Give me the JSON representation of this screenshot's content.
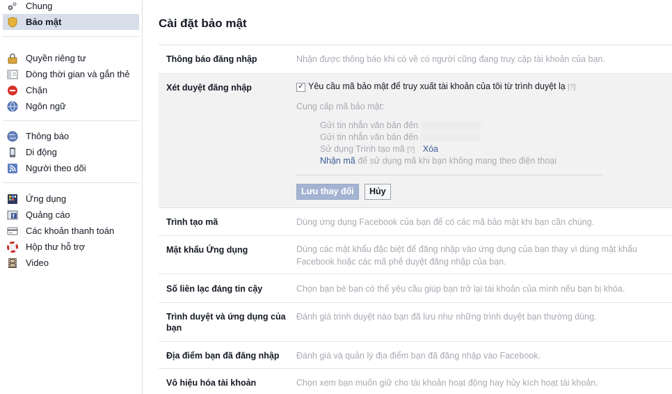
{
  "sidebar": {
    "groups": [
      [
        {
          "label": "Chung",
          "icon": "gears-icon"
        },
        {
          "label": "Bảo mật",
          "icon": "shield-icon",
          "active": true
        }
      ],
      [
        {
          "label": "Quyền riêng tư",
          "icon": "lock-icon"
        },
        {
          "label": "Dòng thời gian và gắn thẻ",
          "icon": "timeline-icon"
        },
        {
          "label": "Chặn",
          "icon": "block-icon"
        },
        {
          "label": "Ngôn ngữ",
          "icon": "globe-icon"
        }
      ],
      [
        {
          "label": "Thông báo",
          "icon": "globe-notification-icon"
        },
        {
          "label": "Di động",
          "icon": "mobile-icon"
        },
        {
          "label": "Người theo dõi",
          "icon": "rss-icon"
        }
      ],
      [
        {
          "label": "Ứng dụng",
          "icon": "apps-icon"
        },
        {
          "label": "Quảng cáo",
          "icon": "ads-icon"
        },
        {
          "label": "Các khoản thanh toán",
          "icon": "credit-card-icon"
        },
        {
          "label": "Hộp thư hỗ trợ",
          "icon": "lifebuoy-icon"
        },
        {
          "label": "Video",
          "icon": "film-icon"
        }
      ]
    ]
  },
  "main": {
    "title": "Cài đặt bảo mật",
    "login_notifications": {
      "label": "Thông báo đăng nhập",
      "desc": "Nhận được thông báo khi có về có người cũng đang truy cập tài khoản của bạn."
    },
    "login_approvals": {
      "label": "Xét duyệt đăng nhập",
      "checkbox_label": "Yêu cầu mã bảo mật để truy xuất tài khoản của tôi từ trình duyệt lạ",
      "checkbox_checked": true,
      "help": "[?]",
      "provide_heading": "Cung cấp mã bảo mật:",
      "sms_1": "Gửi tin nhắn văn bản đến",
      "sms_2": "Gửi tin nhắn văn bản đến",
      "code_gen": "Sử dụng Trình tạo mã",
      "code_gen_help": "[?]",
      "delete_link": "Xóa",
      "get_codes_link": "Nhận mã",
      "get_codes_rest": "để sử dụng mã khi bạn không mang theo điện thoại",
      "save_button": "Lưu thay đổi",
      "cancel_button": "Hủy"
    },
    "rows": [
      {
        "label": "Trình tạo mã",
        "desc": "Dùng ứng dụng Facebook của bạn để có các mã bảo mật khi bạn cần chúng."
      },
      {
        "label": "Mật khẩu Ứng dụng",
        "desc": "Dùng các mật khẩu đặc biệt để đăng nhập vào ứng dụng của bạn thay vì dùng mật khẩu Facebook hoặc các mã phê duyệt đăng nhập của bạn."
      },
      {
        "label": "Số liên lạc đáng tin cậy",
        "desc": "Chọn bạn bè bạn có thể yêu cầu giúp bạn trở lại tài khoản của mình nếu bạn bị khóa."
      },
      {
        "label": "Trình duyệt và ứng dụng của bạn",
        "desc": "Đánh giá trình duyệt nào bạn đã lưu như những trình duyệt bạn thường dùng."
      },
      {
        "label": "Địa điểm bạn đã đăng nhập",
        "desc": "Đánh giá và quản lý địa điểm bạn đã đăng nhập vào Facebook."
      },
      {
        "label": "Vô hiệu hóa tài khoản",
        "desc": "Chọn xem bạn muốn giữ cho tài khoản hoạt động hay hủy kích hoạt tài khoản."
      }
    ]
  }
}
